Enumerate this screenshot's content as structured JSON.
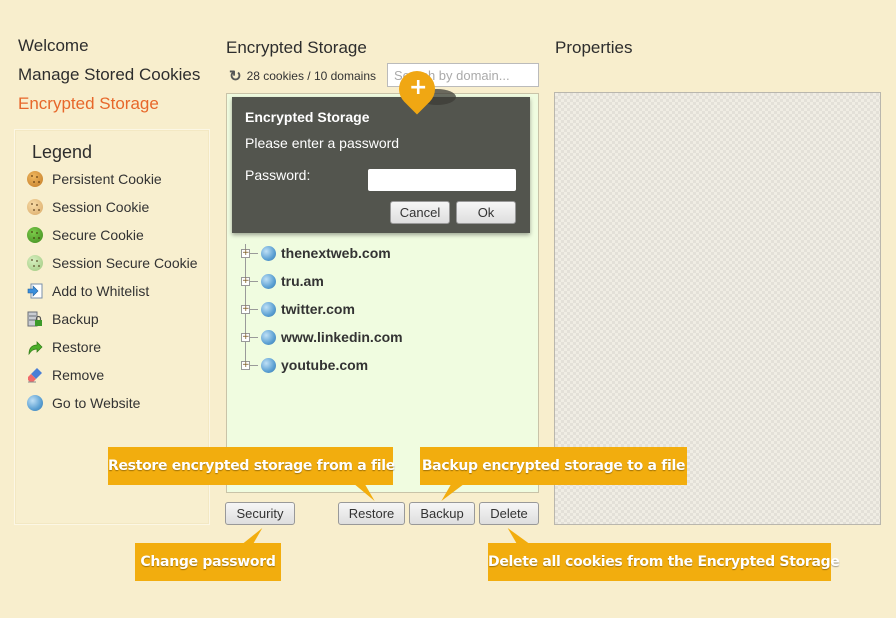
{
  "nav": {
    "items": [
      {
        "label": "Welcome",
        "active": false
      },
      {
        "label": "Manage Stored Cookies",
        "active": false
      },
      {
        "label": "Encrypted Storage",
        "active": true
      }
    ]
  },
  "legend": {
    "title": "Legend",
    "items": [
      {
        "icon": "persistent-cookie-icon",
        "label": "Persistent Cookie"
      },
      {
        "icon": "session-cookie-icon",
        "label": "Session Cookie"
      },
      {
        "icon": "secure-cookie-icon",
        "label": "Secure Cookie"
      },
      {
        "icon": "session-secure-cookie-icon",
        "label": "Session Secure Cookie"
      },
      {
        "icon": "add-to-whitelist-icon",
        "label": "Add to Whitelist"
      },
      {
        "icon": "backup-icon",
        "label": "Backup"
      },
      {
        "icon": "restore-icon",
        "label": "Restore"
      },
      {
        "icon": "remove-icon",
        "label": "Remove"
      },
      {
        "icon": "go-to-website-icon",
        "label": "Go to Website"
      }
    ]
  },
  "storage": {
    "title": "Encrypted Storage",
    "counts": "28 cookies / 10 domains",
    "search_placeholder": "Search by domain...",
    "domains": [
      "thenextweb.com",
      "tru.am",
      "twitter.com",
      "www.linkedin.com",
      "youtube.com"
    ],
    "buttons": {
      "security": "Security",
      "restore": "Restore",
      "backup": "Backup",
      "delete": "Delete"
    }
  },
  "dialog": {
    "title": "Encrypted Storage",
    "message": "Please enter a password",
    "password_label": "Password:",
    "password_value": "",
    "cancel": "Cancel",
    "ok": "Ok"
  },
  "properties": {
    "title": "Properties"
  },
  "callouts": {
    "restore": "Restore encrypted storage from a file",
    "backup": "Backup encrypted storage to a file",
    "security": "Change password",
    "delete": "Delete all cookies from the Encrypted Storage"
  },
  "colors": {
    "accent": "#e7672a",
    "callout": "#f2ad0e",
    "background": "#f8eecd",
    "dialog": "#53554e",
    "tree_bg": "#f0fce0"
  }
}
